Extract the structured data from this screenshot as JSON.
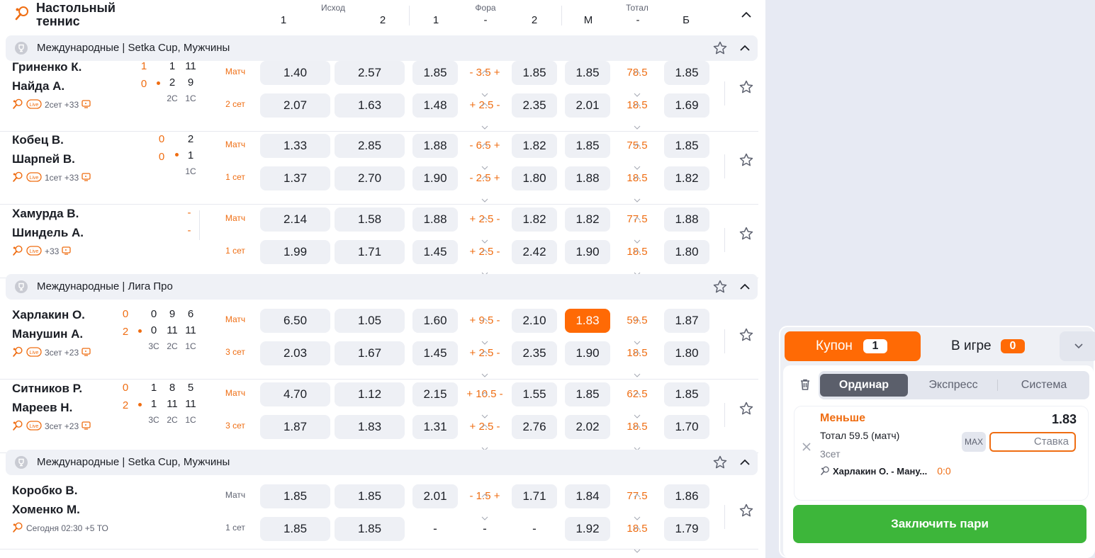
{
  "header": {
    "sport": "Настольный теннис",
    "groups": [
      {
        "label": "Исход",
        "cols": [
          "1",
          "2"
        ]
      },
      {
        "label": "Фора",
        "cols": [
          "1",
          "-",
          "2"
        ]
      },
      {
        "label": "Тотал",
        "cols": [
          "М",
          "-",
          "Б"
        ]
      }
    ]
  },
  "leagues": [
    {
      "name": "Международные | Setka Cup, Мужчины"
    },
    {
      "name": "Международные | Лига Про"
    },
    {
      "name": "Международные | Setka Cup, Мужчины"
    }
  ],
  "matches": [
    {
      "p1": "Гриненко К.",
      "p2": "Найда А.",
      "sets": [
        "1",
        "0"
      ],
      "games": [
        [
          "1",
          "11"
        ],
        [
          "2",
          "9"
        ]
      ],
      "gamecols": [
        "2С",
        "1С"
      ],
      "info": "2сет  +33",
      "label1": "Матч",
      "label2": "2 сет",
      "r1": {
        "o1": "1.40",
        "o2": "2.57",
        "h1": "1.85",
        "hc": "- 3.5 +",
        "h2": "1.85",
        "tm": "1.85",
        "tv": "78.5",
        "tb": "1.85"
      },
      "r2": {
        "o1": "2.07",
        "o2": "1.63",
        "h1": "1.48",
        "hc": "+ 2.5 -",
        "h2": "2.35",
        "tm": "2.01",
        "tv": "18.5",
        "tb": "1.69"
      }
    },
    {
      "p1": "Кобец В.",
      "p2": "Шарпей В.",
      "sets": [
        "0",
        "0"
      ],
      "games": [
        [
          "2"
        ],
        [
          "1"
        ]
      ],
      "gamecols": [
        "1С"
      ],
      "info": "1сет  +33",
      "label1": "Матч",
      "label2": "1 сет",
      "r1": {
        "o1": "1.33",
        "o2": "2.85",
        "h1": "1.88",
        "hc": "- 6.5 +",
        "h2": "1.82",
        "tm": "1.85",
        "tv": "75.5",
        "tb": "1.85"
      },
      "r2": {
        "o1": "1.37",
        "o2": "2.70",
        "h1": "1.90",
        "hc": "- 2.5 +",
        "h2": "1.80",
        "tm": "1.88",
        "tv": "18.5",
        "tb": "1.82"
      }
    },
    {
      "p1": "Хамурда В.",
      "p2": "Шиндель А.",
      "sets": [
        "-",
        "-"
      ],
      "games": [],
      "gamecols": [],
      "info": "+33",
      "label1": "Матч",
      "label2": "1 сет",
      "r1": {
        "o1": "2.14",
        "o2": "1.58",
        "h1": "1.88",
        "hc": "+ 2.5 -",
        "h2": "1.82",
        "tm": "1.82",
        "tv": "77.5",
        "tb": "1.88"
      },
      "r2": {
        "o1": "1.99",
        "o2": "1.71",
        "h1": "1.45",
        "hc": "+ 2.5 -",
        "h2": "2.42",
        "tm": "1.90",
        "tv": "18.5",
        "tb": "1.80"
      }
    },
    {
      "p1": "Харлакин О.",
      "p2": "Манушин А.",
      "sets": [
        "0",
        "2"
      ],
      "games": [
        [
          "0",
          "9",
          "6"
        ],
        [
          "0",
          "11",
          "11"
        ]
      ],
      "gamecols": [
        "3С",
        "2С",
        "1С"
      ],
      "info": "3сет  +23",
      "label1": "Матч",
      "label2": "3 сет",
      "r1": {
        "o1": "6.50",
        "o2": "1.05",
        "h1": "1.60",
        "hc": "+ 9.5 -",
        "h2": "2.10",
        "tm": "1.83",
        "tv": "59.5",
        "tb": "1.87"
      },
      "r2": {
        "o1": "2.03",
        "o2": "1.67",
        "h1": "1.45",
        "hc": "+ 2.5 -",
        "h2": "2.35",
        "tm": "1.90",
        "tv": "18.5",
        "tb": "1.80"
      }
    },
    {
      "p1": "Ситников Р.",
      "p2": "Мареев Н.",
      "sets": [
        "0",
        "2"
      ],
      "games": [
        [
          "1",
          "8",
          "5"
        ],
        [
          "1",
          "11",
          "11"
        ]
      ],
      "gamecols": [
        "3С",
        "2С",
        "1С"
      ],
      "info": "3сет  +23",
      "label1": "Матч",
      "label2": "3 сет",
      "r1": {
        "o1": "4.70",
        "o2": "1.12",
        "h1": "2.15",
        "hc": "+ 10.5 -",
        "h2": "1.55",
        "tm": "1.85",
        "tv": "62.5",
        "tb": "1.85"
      },
      "r2": {
        "o1": "1.87",
        "o2": "1.83",
        "h1": "1.31",
        "hc": "+ 2.5 -",
        "h2": "2.76",
        "tm": "2.02",
        "tv": "18.5",
        "tb": "1.70"
      }
    },
    {
      "p1": "Коробко В.",
      "p2": "Хоменко М.",
      "sets": [],
      "games": [],
      "gamecols": [],
      "info": "Сегодня 02:30  +5  ТО",
      "label1": "Матч",
      "label2": "1 сет",
      "r1": {
        "o1": "1.85",
        "o2": "1.85",
        "h1": "2.01",
        "hc": "- 1.5 +",
        "h2": "1.71",
        "tm": "1.84",
        "tv": "77.5",
        "tb": "1.86"
      },
      "r2": {
        "o1": "1.85",
        "o2": "1.85",
        "h1": "-",
        "hc": "-",
        "h2": "-",
        "tm": "1.92",
        "tv": "18.5",
        "tb": "1.79"
      }
    }
  ],
  "coupon": {
    "tab_coupon": "Купон",
    "coupon_count": "1",
    "tab_live": "В игре",
    "live_count": "0",
    "modes": [
      "Ординар",
      "Экспресс",
      "Система"
    ],
    "bet": {
      "type": "Меньше",
      "odd": "1.83",
      "market": "Тотал 59.5 (матч)",
      "period": "3сет",
      "match": "Харлакин О. - Ману...",
      "score": "0:0",
      "max": "MAX",
      "stake_placeholder": "Ставка"
    },
    "submit": "Заключить пари"
  },
  "colors": {
    "accent": "#ff6a05",
    "orange_text": "#ef6d12",
    "green": "#3db63a",
    "odd_bg": "#eef0f5"
  },
  "icons": [
    "table-tennis-icon",
    "trophy-icon",
    "star-icon",
    "chevron-up-icon",
    "live-icon",
    "tv-icon",
    "trash-icon",
    "close-icon",
    "chevron-down-icon"
  ]
}
